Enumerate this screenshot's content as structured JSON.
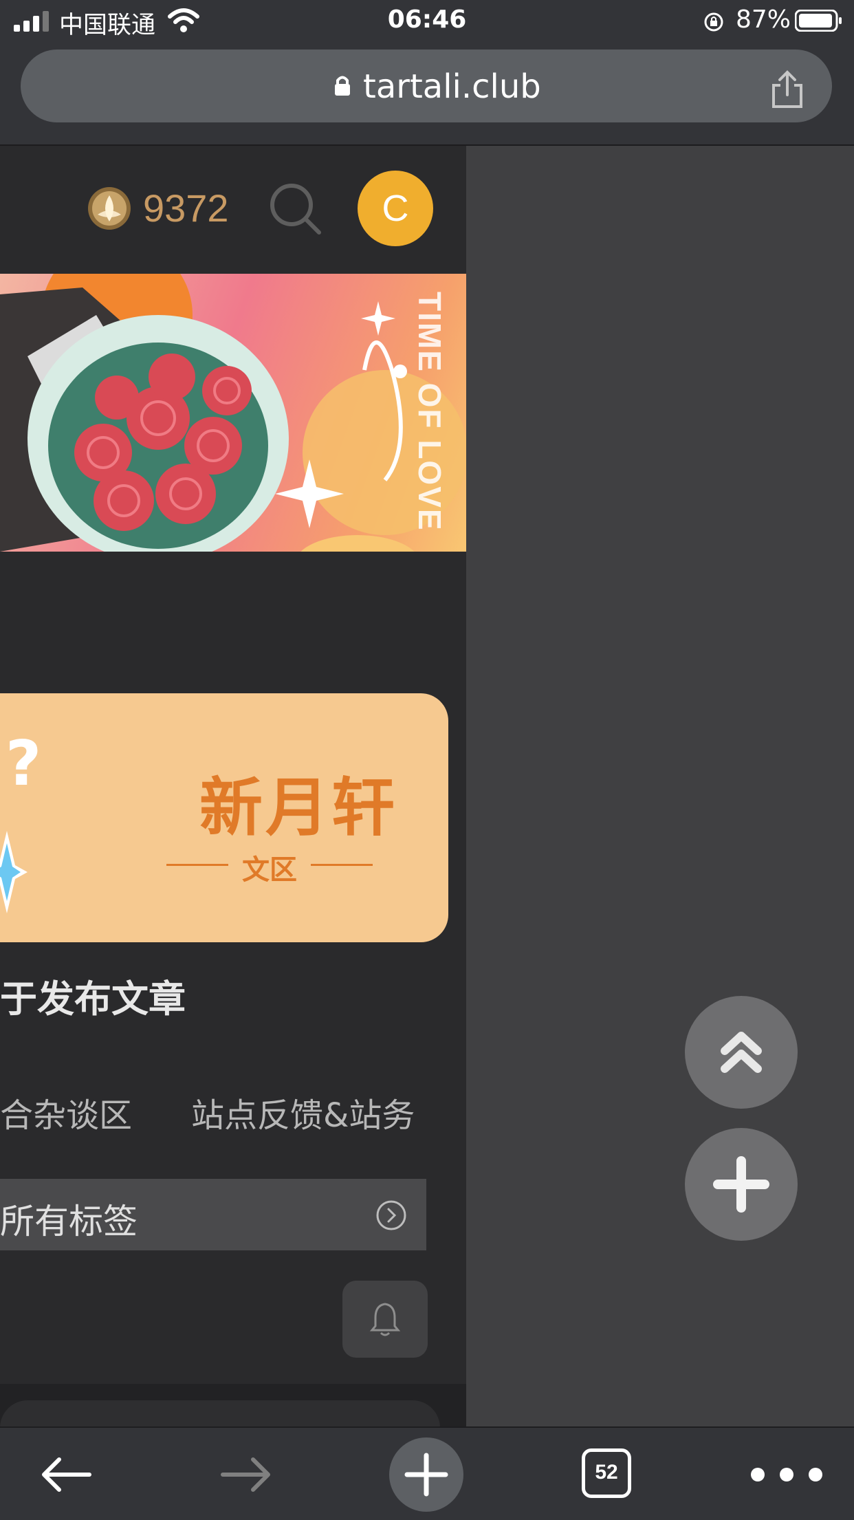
{
  "status_bar": {
    "carrier": "中国联通",
    "time": "06:46",
    "battery_percent": "87%",
    "battery_level": 0.87
  },
  "browser": {
    "url": "tartali.club",
    "tab_count": "52",
    "icons": [
      "lock-icon",
      "share-icon",
      "back-arrow-icon",
      "forward-arrow-icon",
      "plus-icon",
      "tabs-icon",
      "more-icon"
    ]
  },
  "header": {
    "coin_count": "9372",
    "avatar_letter": "C"
  },
  "banner": {
    "text": "TIME OF LOVE"
  },
  "section_card": {
    "title": "新月轩",
    "subtitle": "文区",
    "glyph": "?"
  },
  "post_title": "于发布文章",
  "categories": [
    "合杂谈区",
    "站点反馈&站务"
  ],
  "tags_bar": {
    "label": "所有标签"
  },
  "colors": {
    "accent": "#f0ae2e",
    "coin": "#c89a63",
    "card_bg": "#f6c990",
    "card_text": "#e07a28"
  }
}
